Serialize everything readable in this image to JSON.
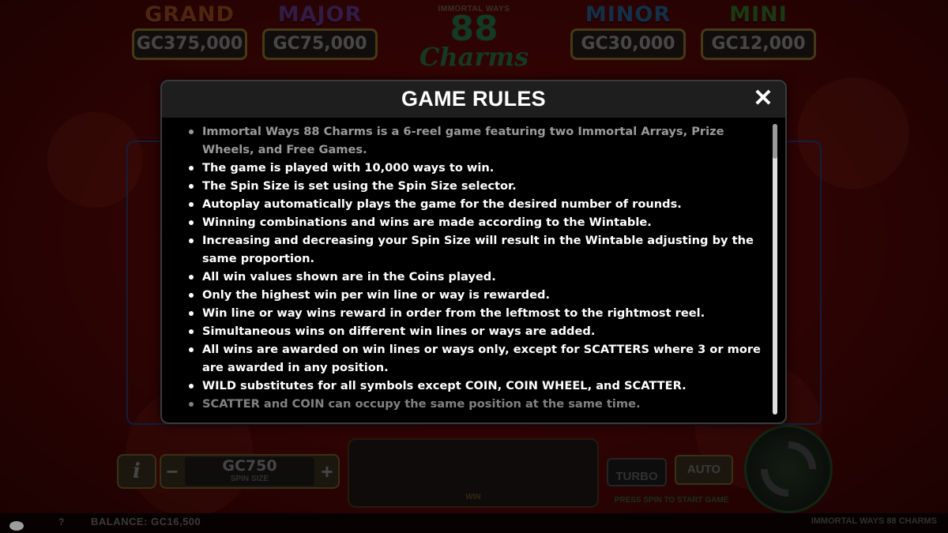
{
  "jackpots": [
    {
      "name": "GRAND",
      "value": "GC375,000"
    },
    {
      "name": "MAJOR",
      "value": "GC75,000"
    },
    {
      "name": "MINOR",
      "value": "GC30,000"
    },
    {
      "name": "MINI",
      "value": "GC12,000"
    }
  ],
  "logo": {
    "top": "IMMORTAL WAYS",
    "number": "88",
    "word": "Charms"
  },
  "modal": {
    "title": "GAME RULES",
    "close_label": "✕",
    "rules": [
      "Immortal Ways 88 Charms is a 6-reel game featuring two Immortal Arrays, Prize Wheels, and Free Games.",
      "The game is played with 10,000 ways to win.",
      "The Spin Size is set using the Spin Size selector.",
      "Autoplay automatically plays the game for the desired number of rounds.",
      "Winning combinations and wins are made according to the Wintable.",
      "Increasing and decreasing your Spin Size will result in the Wintable adjusting by the same proportion.",
      "All win values shown are in the Coins played.",
      "Only the highest win per win line or way is rewarded.",
      "Win line or way wins reward in order from the leftmost to the rightmost reel.",
      "Simultaneous wins on different win lines or ways are added.",
      "All wins are awarded on win lines or ways only, except for SCATTERS where 3 or more are awarded in any position.",
      "WILD substitutes for all symbols except COIN, COIN WHEEL, and SCATTER.",
      "SCATTER and COIN can occupy the same position at the same time."
    ]
  },
  "controls": {
    "info": "i",
    "spin_size_value": "GC750",
    "spin_size_label": "SPIN SIZE",
    "minus": "−",
    "plus": "+",
    "win_label": "WIN",
    "turbo": "TURBO",
    "auto": "AUTO",
    "press_spin": "PRESS SPIN TO START GAME"
  },
  "footer": {
    "help": "?",
    "balance": "BALANCE:  GC16,500",
    "game_name": "IMMORTAL WAYS 88 CHARMS"
  }
}
